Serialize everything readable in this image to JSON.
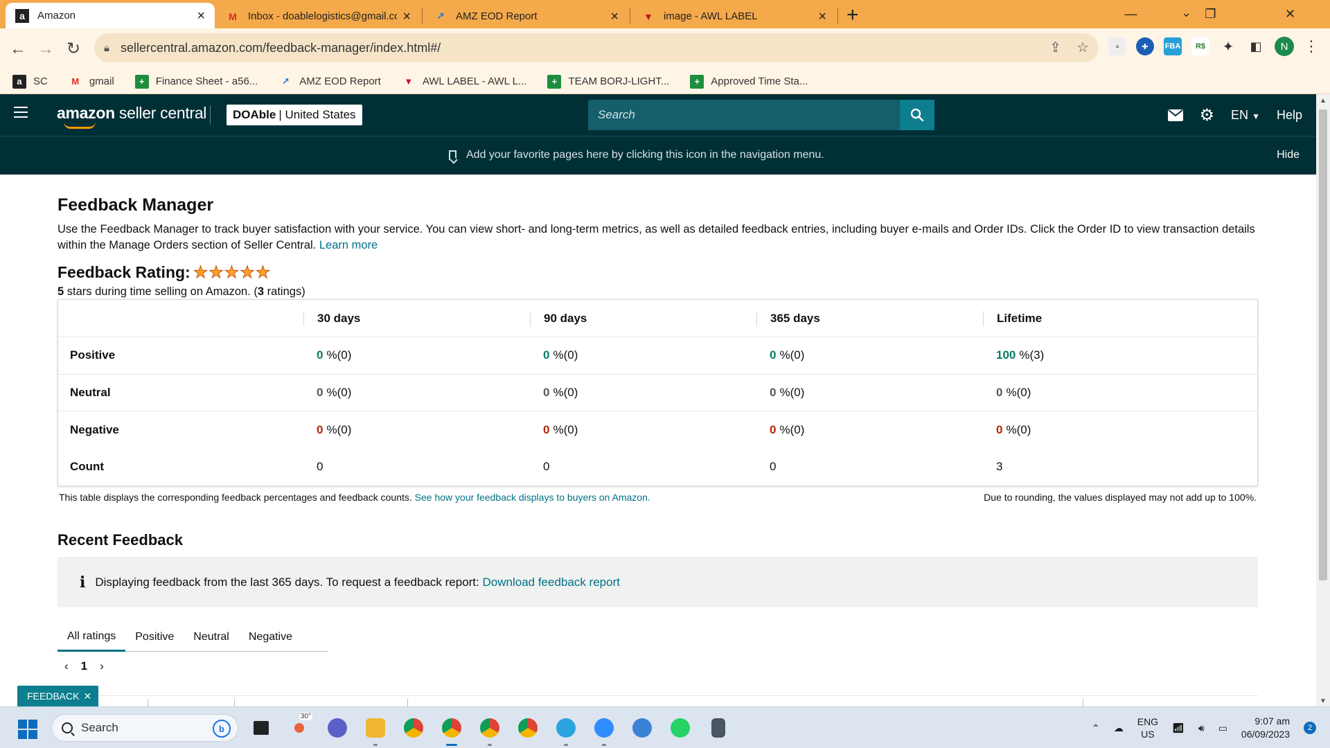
{
  "browser": {
    "tabs": [
      {
        "title": "Amazon",
        "icon": "a",
        "active": true
      },
      {
        "title": "Inbox - doablelogistics@gmail.co",
        "icon": "M",
        "active": false
      },
      {
        "title": "AMZ EOD Report",
        "icon": "↗",
        "active": false
      },
      {
        "title": "image - AWL LABEL",
        "icon": "▼",
        "active": false
      }
    ],
    "url": "sellercentral.amazon.com/feedback-manager/index.html#/",
    "profile_initial": "N",
    "bookmarks": [
      {
        "label": "SC",
        "icon": "a"
      },
      {
        "label": "gmail",
        "icon": "M"
      },
      {
        "label": "Finance Sheet - a56...",
        "icon": "+"
      },
      {
        "label": "AMZ EOD Report",
        "icon": "↗"
      },
      {
        "label": "AWL LABEL - AWL L...",
        "icon": "▼"
      },
      {
        "label": "TEAM BORJ-LIGHT...",
        "icon": "+"
      },
      {
        "label": "Approved Time Sta...",
        "icon": "+"
      }
    ]
  },
  "header": {
    "logo_bold": "amazon",
    "logo_rest": " seller central",
    "store_name": "DOAble",
    "store_region": "| United States",
    "search_placeholder": "Search",
    "language": "EN",
    "help": "Help"
  },
  "favorites_bar": {
    "message": "Add your favorite pages here by clicking this icon in the navigation menu.",
    "hide": "Hide"
  },
  "page": {
    "title": "Feedback Manager",
    "intro": "Use the Feedback Manager to track buyer satisfaction with your service. You can view short- and long-term metrics, as well as detailed feedback entries, including buyer e-mails and Order IDs. Click the Order ID to view transaction details within the Manage Orders section of Seller Central.",
    "learn_more": "Learn more",
    "rating_label": "Feedback Rating:",
    "rating_stars": 5,
    "rating_stars_value": "5",
    "rating_sub_mid": " stars during time selling on Amazon. (",
    "rating_count": "3",
    "rating_sub_end": " ratings)"
  },
  "feedback_table": {
    "columns": [
      "30 days",
      "90 days",
      "365 days",
      "Lifetime"
    ],
    "rows": [
      {
        "label": "Positive",
        "color": "green",
        "cells": [
          {
            "pct": "0",
            "cnt": "%(0)"
          },
          {
            "pct": "0",
            "cnt": "%(0)"
          },
          {
            "pct": "0",
            "cnt": "%(0)"
          },
          {
            "pct": "100",
            "cnt": "%(3)"
          }
        ]
      },
      {
        "label": "Neutral",
        "color": "grey",
        "cells": [
          {
            "pct": "0",
            "cnt": "%(0)"
          },
          {
            "pct": "0",
            "cnt": "%(0)"
          },
          {
            "pct": "0",
            "cnt": "%(0)"
          },
          {
            "pct": "0",
            "cnt": "%(0)"
          }
        ]
      },
      {
        "label": "Negative",
        "color": "red",
        "cells": [
          {
            "pct": "0",
            "cnt": "%(0)"
          },
          {
            "pct": "0",
            "cnt": "%(0)"
          },
          {
            "pct": "0",
            "cnt": "%(0)"
          },
          {
            "pct": "0",
            "cnt": "%(0)"
          }
        ]
      }
    ],
    "count_label": "Count",
    "counts": [
      "0",
      "0",
      "0",
      "3"
    ],
    "note": "This table displays the corresponding feedback percentages and feedback counts.",
    "note_link": "See how your feedback displays to buyers on Amazon.",
    "rounding_note": "Due to rounding, the values displayed may not add up to 100%."
  },
  "recent": {
    "title": "Recent Feedback",
    "info": "Displaying feedback from the last 365 days. To request a feedback report:",
    "info_link": "Download feedback report",
    "tabs": [
      "All ratings",
      "Positive",
      "Neutral",
      "Negative"
    ],
    "active_tab": 0,
    "page": "1"
  },
  "feedback_button": "FEEDBACK",
  "taskbar": {
    "search": "Search",
    "weather_temp": "30°",
    "lang_line1": "ENG",
    "lang_line2": "US",
    "time": "9:07 am",
    "date": "06/09/2023",
    "notifications": "2"
  }
}
